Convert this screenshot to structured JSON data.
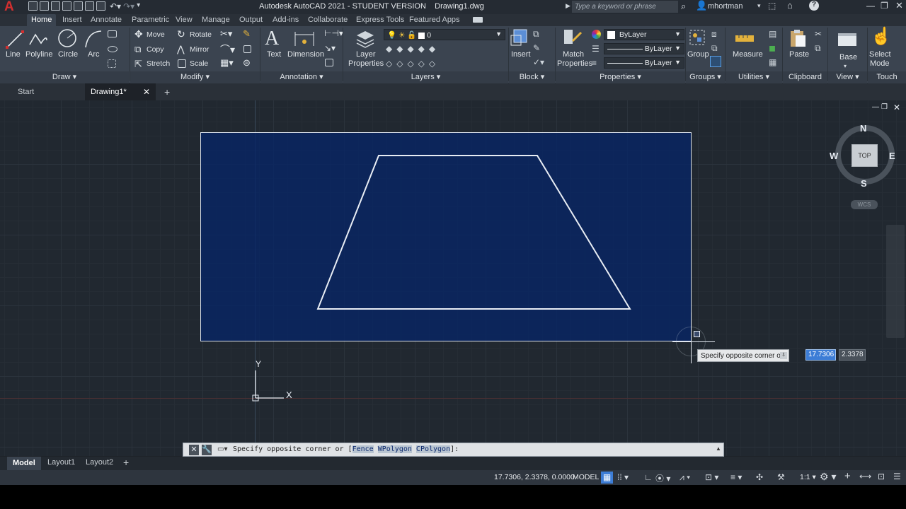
{
  "app": {
    "title": "Autodesk AutoCAD 2021 - STUDENT VERSION    Drawing1.dwg",
    "search_placeholder": "Type a keyword or phrase",
    "user": "mhortman"
  },
  "ribbon_tabs": [
    "Home",
    "Insert",
    "Annotate",
    "Parametric",
    "View",
    "Manage",
    "Output",
    "Add-ins",
    "Collaborate",
    "Express Tools",
    "Featured Apps"
  ],
  "draw": {
    "line": "Line",
    "polyline": "Polyline",
    "circle": "Circle",
    "arc": "Arc",
    "footer": "Draw"
  },
  "modify": {
    "move": "Move",
    "rotate": "Rotate",
    "copy": "Copy",
    "mirror": "Mirror",
    "stretch": "Stretch",
    "scale": "Scale",
    "footer": "Modify"
  },
  "annotation": {
    "text": "Text",
    "dimension": "Dimension",
    "footer": "Annotation"
  },
  "layers": {
    "layer_properties_1": "Layer",
    "layer_properties_2": "Properties",
    "current_layer": "0",
    "footer": "Layers"
  },
  "block": {
    "insert": "Insert",
    "footer": "Block"
  },
  "properties": {
    "match_1": "Match",
    "match_2": "Properties",
    "color": "ByLayer",
    "linetype": "ByLayer",
    "lineweight": "ByLayer",
    "footer": "Properties"
  },
  "groups": {
    "group": "Group",
    "footer": "Groups"
  },
  "utilities": {
    "measure": "Measure",
    "footer": "Utilities"
  },
  "clipboard": {
    "paste": "Paste",
    "footer": "Clipboard"
  },
  "view": {
    "base": "Base",
    "footer": "View"
  },
  "touch": {
    "select_1": "Select",
    "select_2": "Mode",
    "footer": "Touch"
  },
  "doc_tabs": {
    "start": "Start",
    "drawing": "Drawing1*"
  },
  "viewcube": {
    "n": "N",
    "s": "S",
    "e": "E",
    "w": "W",
    "top": "TOP",
    "wcs": "WCS"
  },
  "ucs": {
    "x": "X",
    "y": "Y"
  },
  "dynamic_input": {
    "prompt": "Specify opposite corner or",
    "x": "17.7306",
    "y": "2.3378"
  },
  "command_line": {
    "prefix": "Specify opposite corner or [",
    "opt1": "Fence",
    "opt2": "WPolygon",
    "opt3": "CPolygon",
    "suffix": "]:"
  },
  "layout_tabs": [
    "Model",
    "Layout1",
    "Layout2"
  ],
  "status": {
    "coords": "17.7306, 2.3378, 0.0000",
    "space": "MODEL",
    "scale": "1:1"
  }
}
